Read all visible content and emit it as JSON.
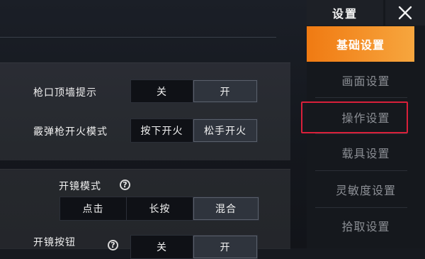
{
  "sidebar": {
    "title": "设置",
    "items": [
      {
        "label": "基础设置",
        "active": true
      },
      {
        "label": "画面设置"
      },
      {
        "label": "操作设置",
        "highlighted": true
      },
      {
        "label": "载具设置"
      },
      {
        "label": "灵敏度设置"
      },
      {
        "label": "拾取设置"
      }
    ]
  },
  "settings": {
    "muzzle_wall_hint": {
      "label": "枪口顶墙提示",
      "options": [
        "关",
        "开"
      ],
      "selected": "开"
    },
    "shotgun_fire_mode": {
      "label": "霰弹枪开火模式",
      "options": [
        "按下开火",
        "松手开火"
      ],
      "selected": "松手开火"
    },
    "scope_mode": {
      "label": "开镜模式",
      "options": [
        "点击",
        "长按",
        "混合"
      ],
      "selected": "混合"
    },
    "scope_button": {
      "label": "开镜按钮",
      "options": [
        "关",
        "开"
      ],
      "selected": "开"
    }
  },
  "colors": {
    "accent": "#f28a1e",
    "highlight_border": "#d9203a"
  }
}
